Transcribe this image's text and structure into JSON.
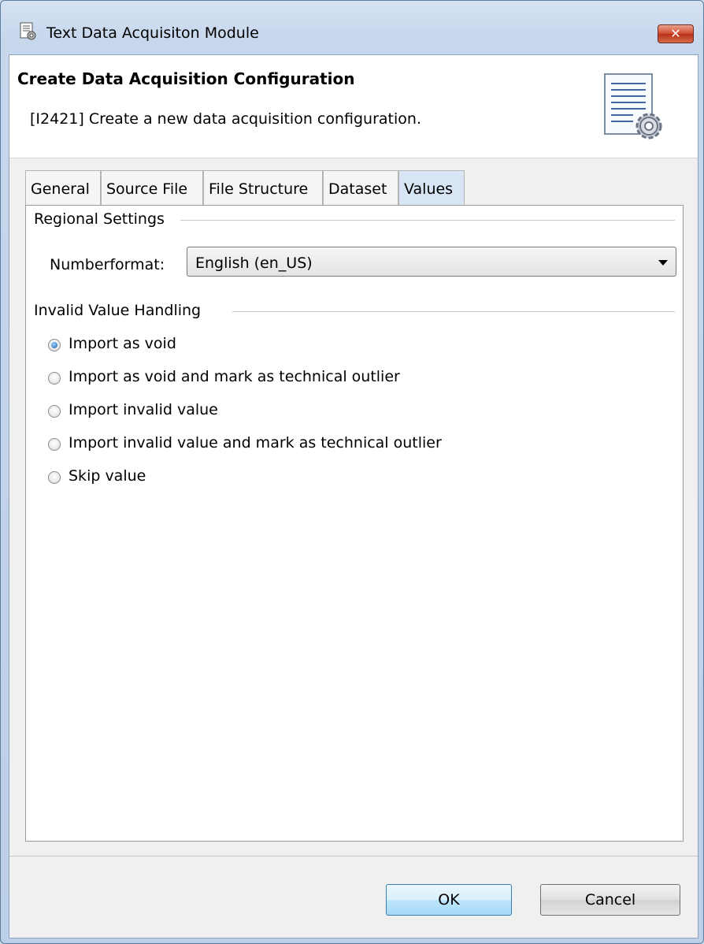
{
  "window": {
    "title": "Text Data Acquisiton Module",
    "close_label": "✕"
  },
  "header": {
    "title": "Create Data Acquisition Configuration",
    "description": "[I2421] Create a new data acquisition configuration."
  },
  "tabs": [
    {
      "label": "General",
      "active": false
    },
    {
      "label": "Source File",
      "active": false
    },
    {
      "label": "File Structure",
      "active": false
    },
    {
      "label": "Dataset",
      "active": false
    },
    {
      "label": "Values",
      "active": true
    }
  ],
  "regional_settings": {
    "group_label": "Regional Settings",
    "numberformat_label": "Numberformat:",
    "numberformat_value": "English (en_US)"
  },
  "invalid_value_handling": {
    "group_label": "Invalid Value Handling",
    "options": [
      {
        "label": "Import as void",
        "checked": true
      },
      {
        "label": "Import as void and mark as technical outlier",
        "checked": false
      },
      {
        "label": "Import invalid value",
        "checked": false
      },
      {
        "label": "Import invalid value and mark as technical outlier",
        "checked": false
      },
      {
        "label": "Skip value",
        "checked": false
      }
    ]
  },
  "buttons": {
    "ok_label": "OK",
    "cancel_label": "Cancel"
  },
  "colors": {
    "active_tab": "#d7e5f5",
    "close_button": "#cf4a2c",
    "default_button_border": "#3c7fb1"
  }
}
